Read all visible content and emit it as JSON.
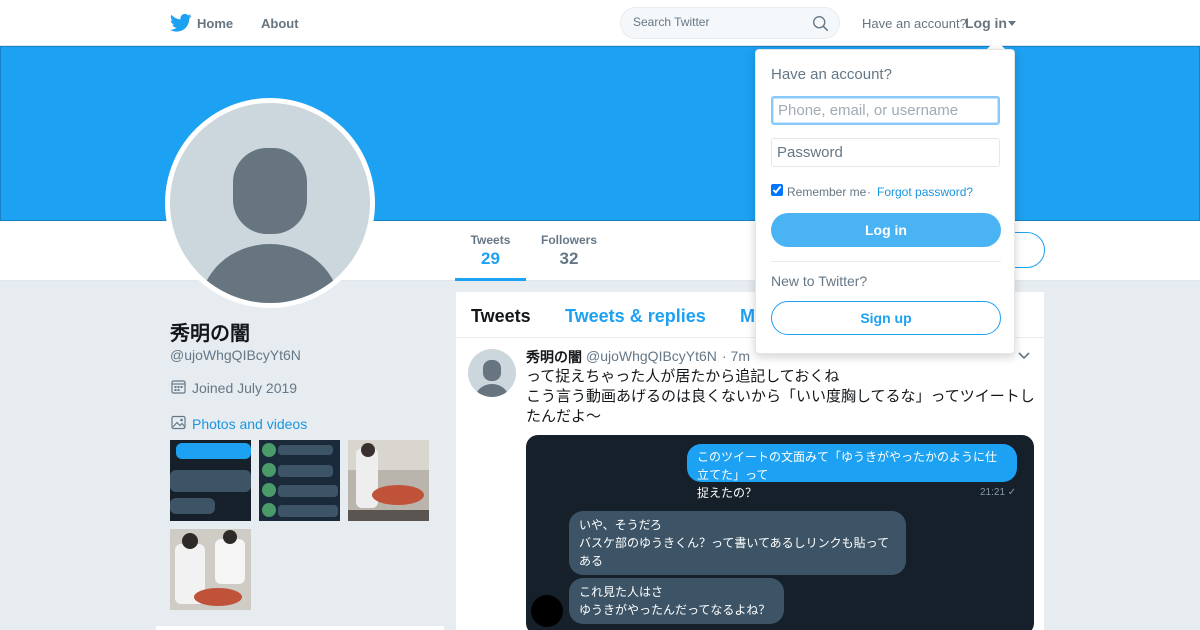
{
  "nav": {
    "home_label": "Home",
    "about_label": "About",
    "search_placeholder": "Search Twitter",
    "have_account": "Have an account?",
    "login_label": "Log in"
  },
  "profile": {
    "name": "秀明の闇",
    "handle": "@ujoWhgQIBcyYt6N",
    "joined": "Joined July 2019",
    "photos_label": "Photos and videos",
    "stats": [
      {
        "label": "Tweets",
        "value": "29"
      },
      {
        "label": "Followers",
        "value": "32"
      }
    ]
  },
  "tabs": {
    "tweets": "Tweets",
    "replies": "Tweets & replies",
    "media": "M"
  },
  "tweet": {
    "name": "秀明の闇",
    "handle": "@ujoWhgQIBcyYt6N",
    "time": "· 7m",
    "text_line1": "って捉えちゃった人が居たから追記しておくね",
    "text_line2": "こう言う動画あげるのは良くないから「いい度胸してるな」ってツイートしたんだよ〜",
    "chat": {
      "blue_line1": "このツイートの文面みて「ゆうきがやったかのように仕立てた」って",
      "blue_line2": "捉えたの？",
      "time": "21:21 ✓",
      "gray1_line1": "いや、そうだろ",
      "gray1_line2": "バスケ部のゆうきくん？って書いてあるしリンクも貼って",
      "gray1_line3": "ある",
      "gray2_line1": "これ見た人はさ",
      "gray2_line2": "ゆうきがやったんだってなるよね？"
    }
  },
  "login_dropdown": {
    "title": "Have an account?",
    "user_placeholder": "Phone, email, or username",
    "password_placeholder": "Password",
    "remember": "Remember me",
    "separator": "·",
    "forgot": "Forgot password?",
    "login_button": "Log in",
    "new_to": "New to Twitter?",
    "signup_button": "Sign up"
  },
  "colors": {
    "brand": "#1da1f2",
    "banner": "#1da1f2",
    "background": "#e6ecf0"
  }
}
